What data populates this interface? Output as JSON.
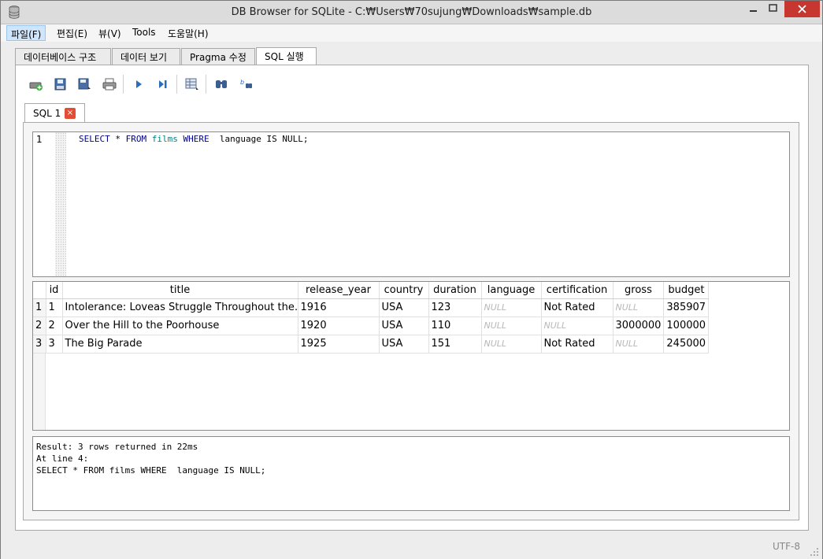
{
  "window": {
    "title": "DB Browser for SQLite - C:₩Users₩70sujung₩Downloads₩sample.db"
  },
  "menu": [
    "파일(F)",
    "편집(E)",
    "뷰(V)",
    "Tools",
    "도움말(H)"
  ],
  "main_tabs": [
    "데이터베이스 구조",
    "데이터 보기",
    "Pragma 수정",
    "SQL 실행"
  ],
  "toolbar": {
    "icons": [
      "open-tab-icon",
      "open-sql-icon",
      "save-sql-icon",
      "print-icon",
      "execute-all-icon",
      "execute-line-icon",
      "save-results-icon",
      "find-icon",
      "find-replace-icon"
    ]
  },
  "sql_tab": {
    "label": "SQL 1",
    "close": "×"
  },
  "editor": {
    "line_number": "1",
    "tokens": {
      "select": "SELECT",
      "star": " * ",
      "from": "FROM",
      "table": "films",
      "where": "WHERE",
      "condition": "  language IS NULL;"
    }
  },
  "results": {
    "columns": [
      "id",
      "title",
      "release_year",
      "country",
      "duration",
      "language",
      "certification",
      "gross",
      "budget"
    ],
    "rows": [
      {
        "rownum": "1",
        "cells": [
          "1",
          "Intolerance: Loveas Struggle Throughout the…",
          "1916",
          "USA",
          "123",
          "NULL",
          "Not Rated",
          "NULL",
          "385907"
        ]
      },
      {
        "rownum": "2",
        "cells": [
          "2",
          "Over the Hill to the Poorhouse",
          "1920",
          "USA",
          "110",
          "NULL",
          "NULL",
          "3000000",
          "100000"
        ]
      },
      {
        "rownum": "3",
        "cells": [
          "3",
          "The Big Parade",
          "1925",
          "USA",
          "151",
          "NULL",
          "Not Rated",
          "NULL",
          "245000"
        ]
      }
    ]
  },
  "output": {
    "line1": "Result: 3 rows returned in 22ms",
    "line2": "At line 4:",
    "line3": "SELECT * FROM films WHERE  language IS NULL;"
  },
  "status": {
    "encoding": "UTF-8"
  }
}
